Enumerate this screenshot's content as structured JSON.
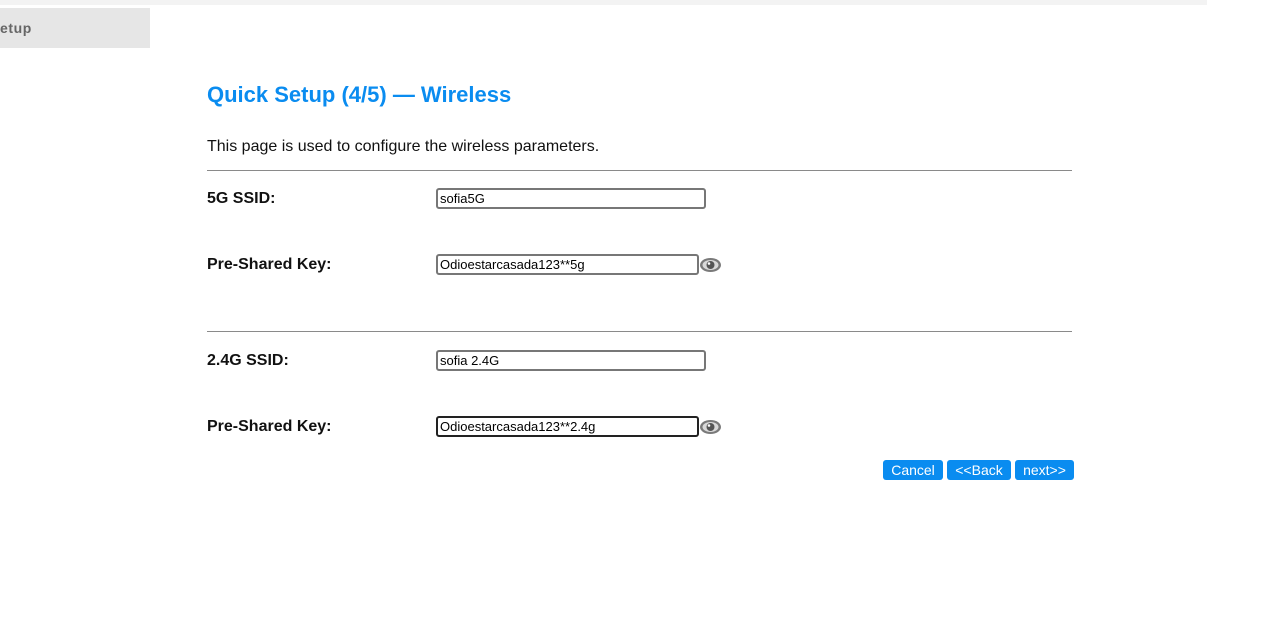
{
  "sidebar": {
    "active_tab_label": "etup"
  },
  "header": {
    "title": "Quick Setup (4/5) — Wireless",
    "description": "This page is used to configure the wireless parameters."
  },
  "form": {
    "band_5g": {
      "ssid_label": "5G SSID:",
      "ssid_value": "sofia5G",
      "key_label": "Pre-Shared Key:",
      "key_value": "Odioestarcasada123**5g",
      "show_key_icon": "eye-icon"
    },
    "band_24g": {
      "ssid_label": "2.4G SSID:",
      "ssid_value": "sofia 2.4G",
      "key_label": "Pre-Shared Key:",
      "key_value": "Odioestarcasada123**2.4g",
      "show_key_icon": "eye-icon"
    }
  },
  "actions": {
    "cancel_label": "Cancel",
    "back_label": "<<Back",
    "next_label": "next>>"
  },
  "colors": {
    "accent": "#0a8cf0",
    "sidebar_bg": "#e6e6e6",
    "text": "#111111"
  }
}
